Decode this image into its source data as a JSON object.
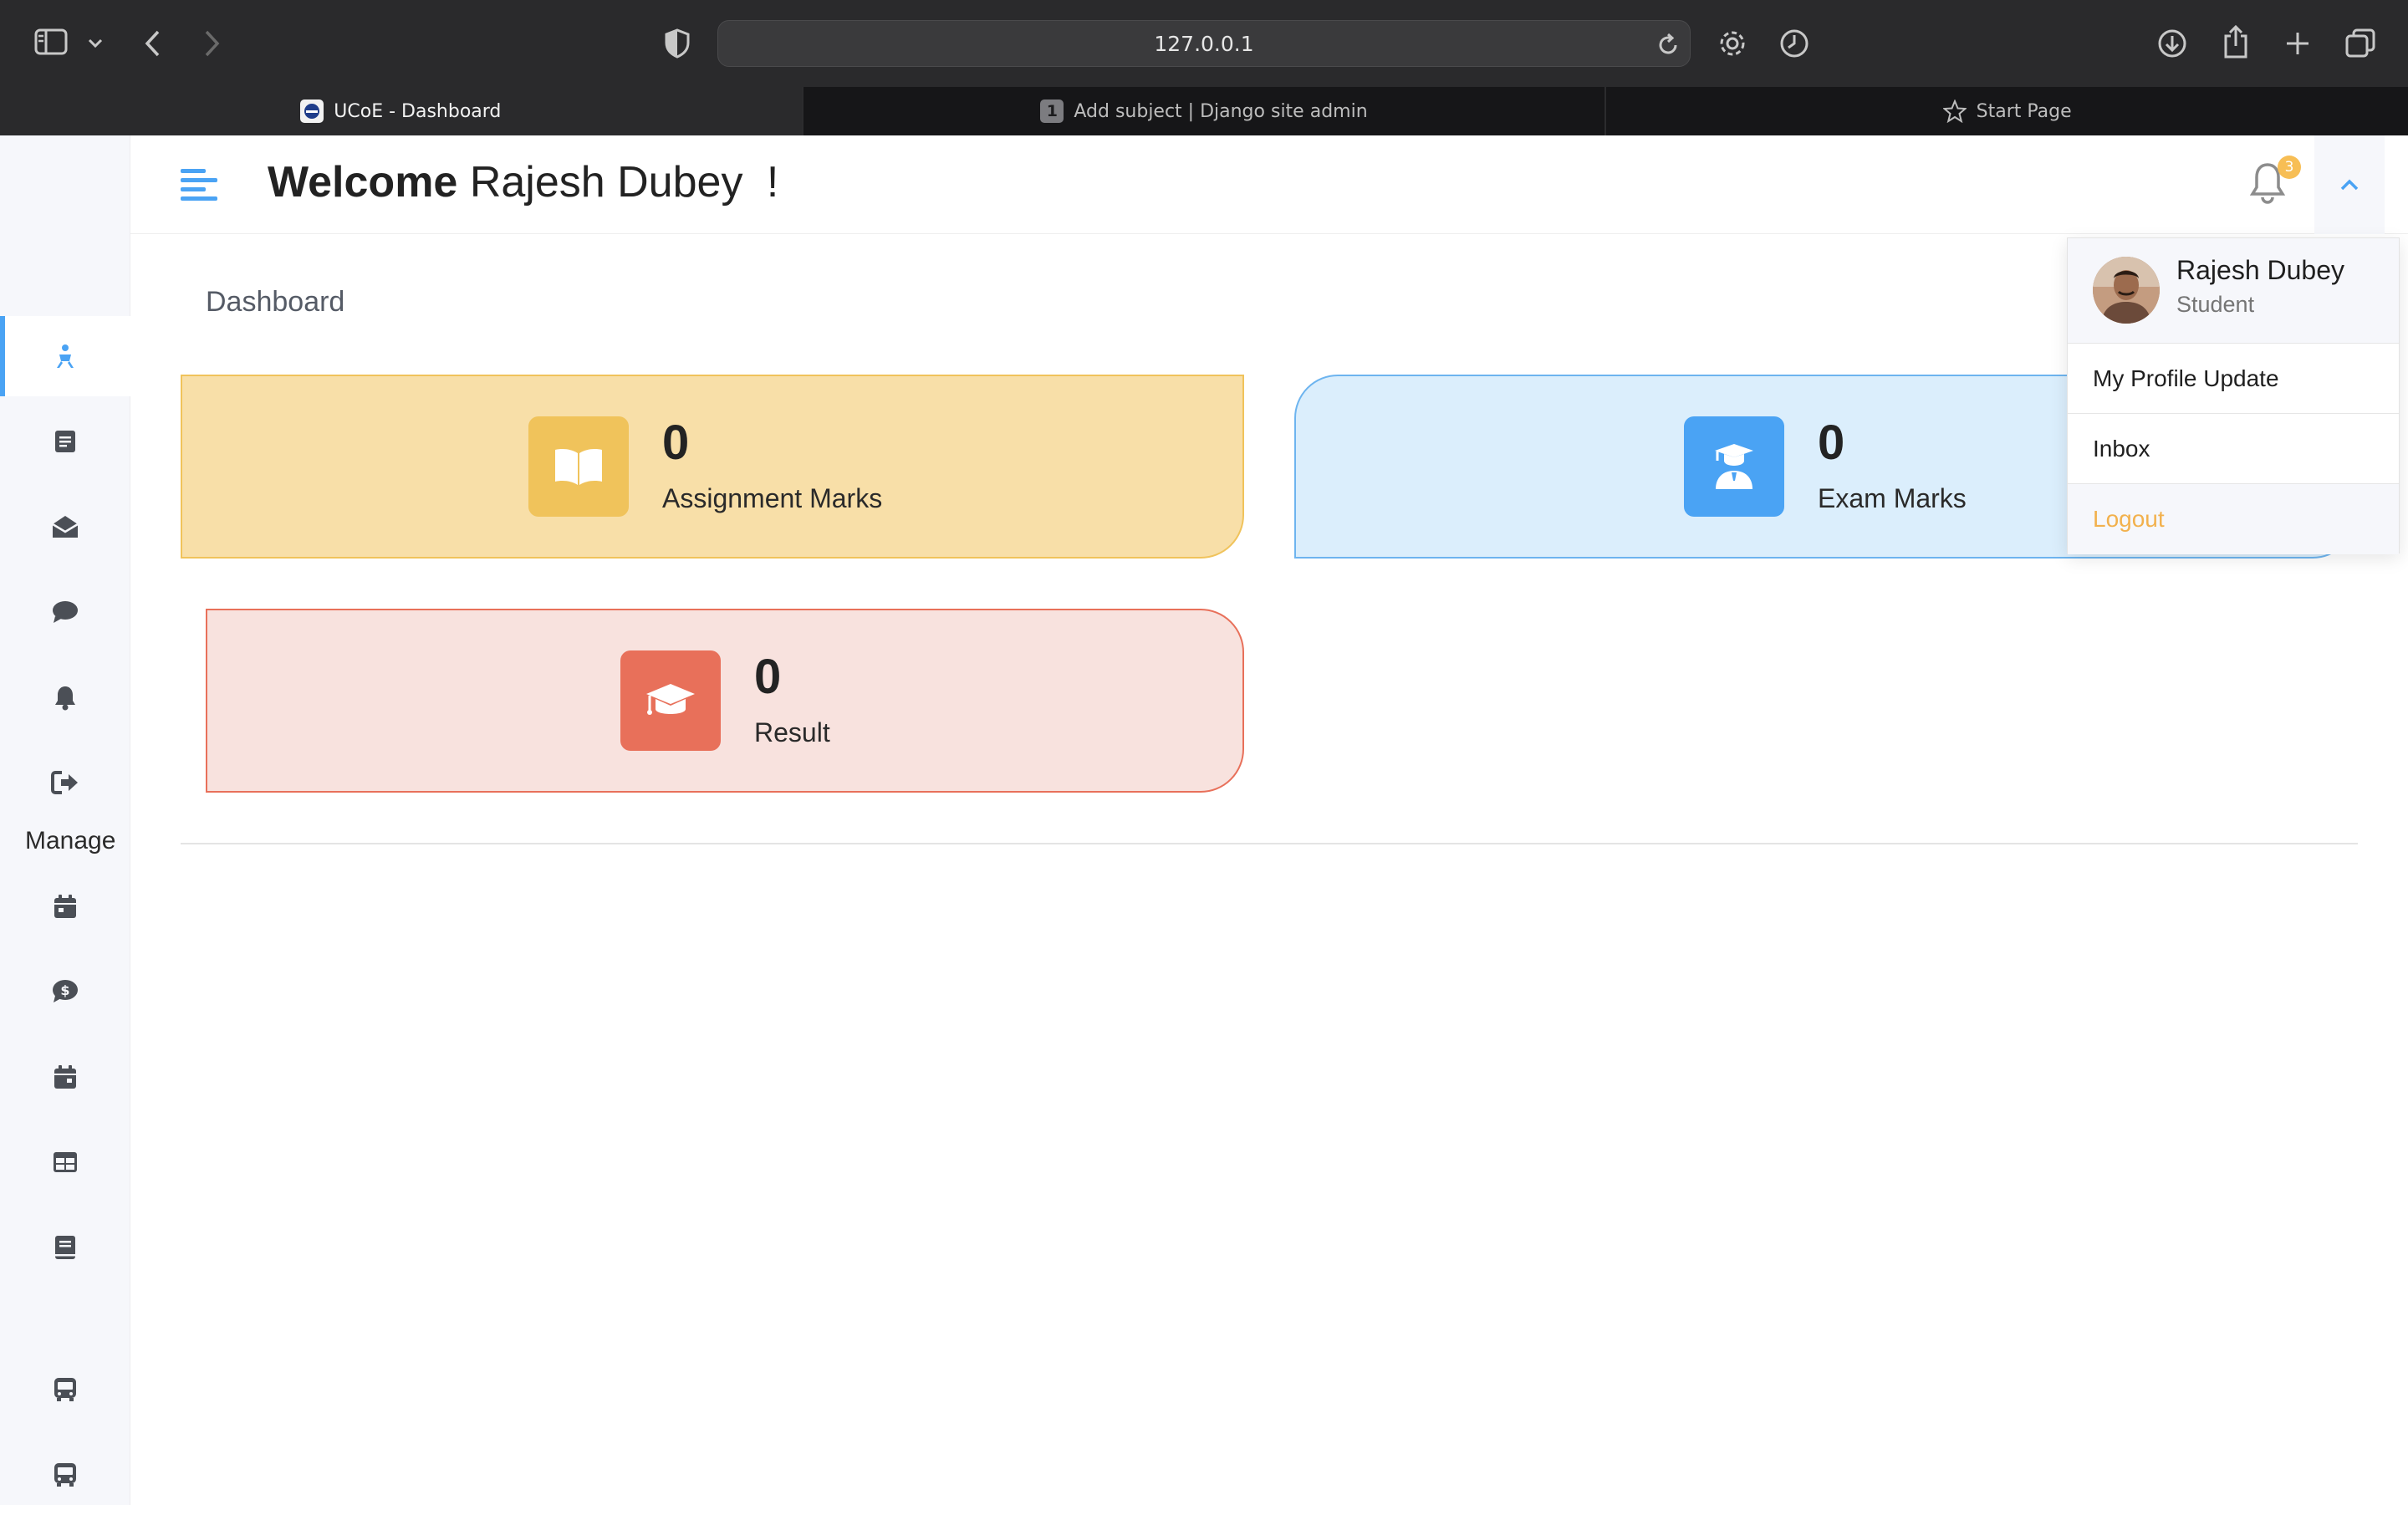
{
  "browser": {
    "url": "127.0.0.1",
    "tabs": [
      {
        "label": "UCoE - Dashboard",
        "active": true
      },
      {
        "label": "Add subject | Django site admin",
        "badge": "1",
        "active": false
      },
      {
        "label": "Start Page",
        "active": false
      }
    ],
    "icons": [
      "sidebar-toggle-icon",
      "chevron-down-icon",
      "back-icon",
      "forward-icon",
      "shield-icon",
      "reload-icon",
      "settings-gear-icon",
      "history-clock-icon",
      "download-icon",
      "share-icon",
      "new-tab-plus-icon",
      "tab-overview-icon"
    ]
  },
  "header": {
    "welcome_bold": "Welcome",
    "welcome_name": "Rajesh Dubey",
    "welcome_suffix": "!",
    "notification_count": "3"
  },
  "sidebar": {
    "manage_label": "Manage",
    "icons": [
      "dashboard-icon",
      "assignment-icon",
      "inbox-icon",
      "chat-icon",
      "notification-icon",
      "logout-icon",
      "calendar-icon",
      "fees-dollar-icon",
      "calendar-icon",
      "table-icon",
      "book-icon",
      "bus-icon",
      "bus-icon"
    ]
  },
  "page": {
    "breadcrumb": "Dashboard"
  },
  "cards": [
    {
      "value": "0",
      "label": "Assignment Marks",
      "color": "#f0c35b",
      "icon": "book-open-icon"
    },
    {
      "value": "0",
      "label": "Exam Marks",
      "color": "#4aa3f4",
      "icon": "graduate-user-icon"
    },
    {
      "value": "0",
      "label": "Result",
      "color": "#e8705a",
      "icon": "graduation-cap-icon"
    }
  ],
  "dropdown": {
    "name": "Rajesh Dubey",
    "role": "Student",
    "items": [
      "My Profile Update",
      "Inbox",
      "Logout"
    ]
  },
  "colors": {
    "accent": "#4aa3f4",
    "logout": "#f2b14d",
    "badge": "#f7be55"
  }
}
